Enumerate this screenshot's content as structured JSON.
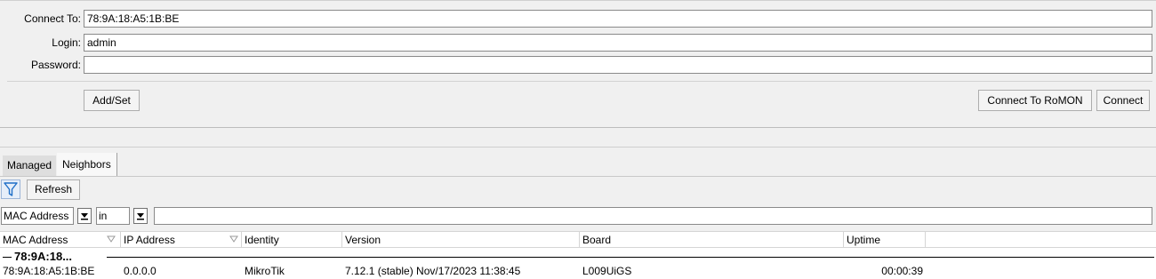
{
  "form": {
    "connect_to_label": "Connect To:",
    "connect_to_value": "78:9A:18:A5:1B:BE",
    "login_label": "Login:",
    "login_value": "admin",
    "password_label": "Password:",
    "password_value": ""
  },
  "buttons": {
    "add_set": "Add/Set",
    "connect_romon": "Connect To RoMON",
    "connect": "Connect"
  },
  "tabs": [
    {
      "label": "Managed",
      "active": false
    },
    {
      "label": "Neighbors",
      "active": true
    }
  ],
  "toolbar": {
    "filter_icon": "filter-icon",
    "refresh_label": "Refresh"
  },
  "filter": {
    "field_value": "MAC Address",
    "operator_value": "in",
    "text_value": ""
  },
  "table": {
    "columns": [
      "MAC Address",
      "IP Address",
      "Identity",
      "Version",
      "Board",
      "Uptime"
    ],
    "group_label": "78:9A:18...",
    "rows": [
      {
        "mac": "78:9A:18:A5:1B:BE",
        "ip": "0.0.0.0",
        "identity": "MikroTik",
        "version": "7.12.1 (stable) Nov/17/2023 11:38:45",
        "board": "L009UiGS",
        "uptime": "00:00:39"
      }
    ]
  },
  "colors": {
    "background": "#f0f0f0",
    "field_border": "#8a8a8a",
    "filter_icon": "#1f6fc8"
  }
}
